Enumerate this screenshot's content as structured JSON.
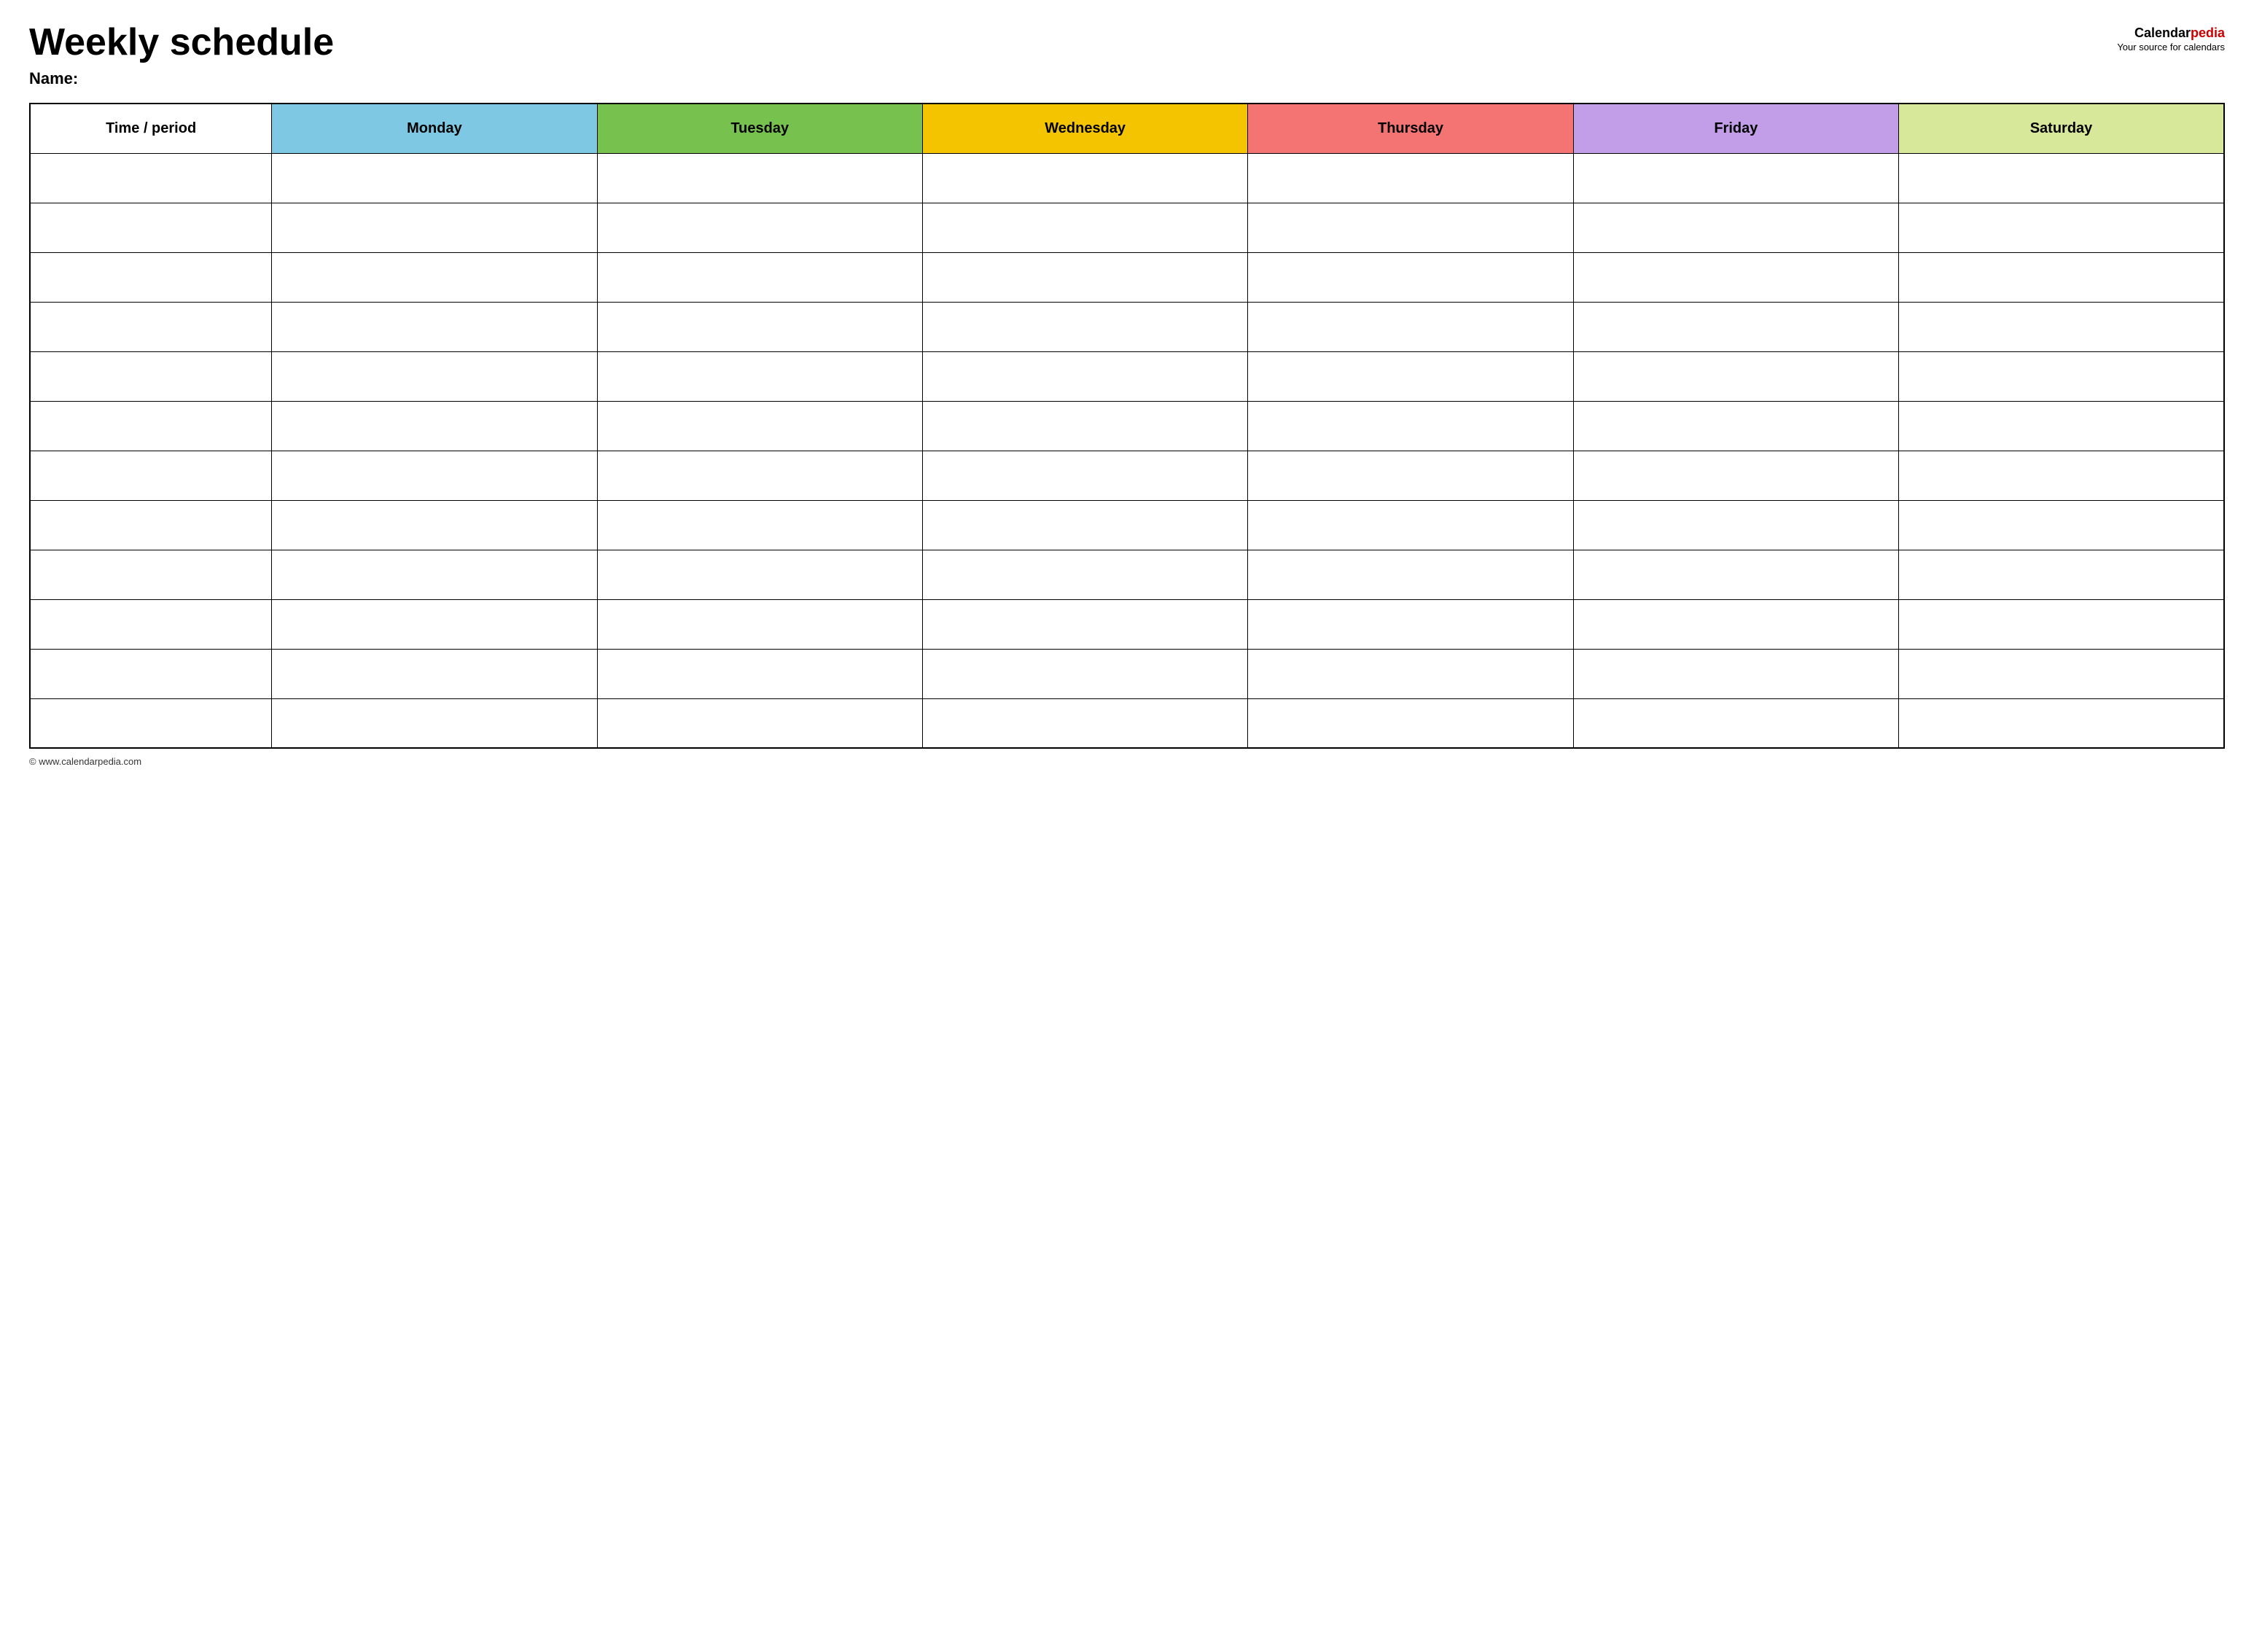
{
  "header": {
    "title": "Weekly schedule",
    "name_label": "Name:",
    "logo_calendar": "Calendar",
    "logo_pedia": "pedia",
    "logo_subtitle": "Your source for calendars"
  },
  "table": {
    "columns": [
      {
        "key": "time",
        "label": "Time / period",
        "color": "#ffffff"
      },
      {
        "key": "monday",
        "label": "Monday",
        "color": "#7ec8e3"
      },
      {
        "key": "tuesday",
        "label": "Tuesday",
        "color": "#77c24e"
      },
      {
        "key": "wednesday",
        "label": "Wednesday",
        "color": "#f5c400"
      },
      {
        "key": "thursday",
        "label": "Thursday",
        "color": "#f47474"
      },
      {
        "key": "friday",
        "label": "Friday",
        "color": "#c39ee8"
      },
      {
        "key": "saturday",
        "label": "Saturday",
        "color": "#d8e89a"
      }
    ],
    "row_count": 12
  },
  "footer": {
    "url": "© www.calendarpedia.com"
  }
}
